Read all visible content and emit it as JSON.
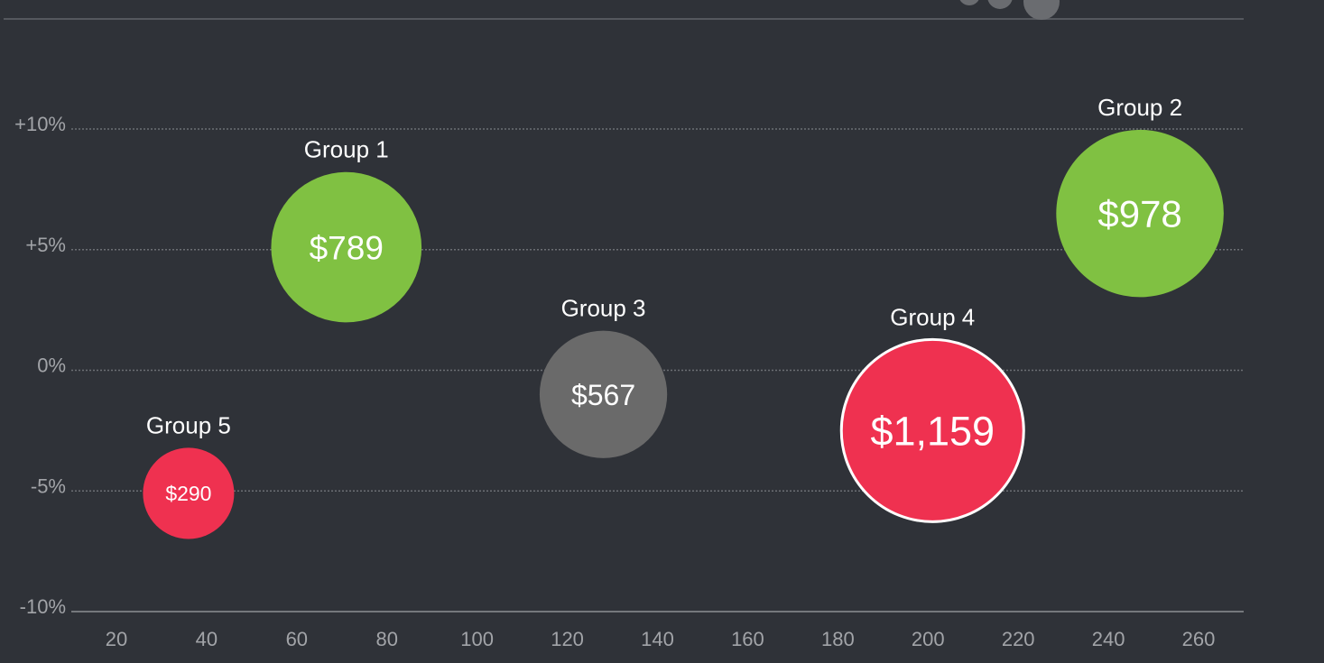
{
  "chart_data": {
    "type": "scatter",
    "title": "",
    "xlabel": "",
    "ylabel": "",
    "xlim": [
      10,
      270
    ],
    "ylim": [
      -10,
      10
    ],
    "x_ticks": [
      20,
      40,
      60,
      80,
      100,
      120,
      140,
      160,
      180,
      200,
      220,
      240,
      260
    ],
    "x_tick_labels": [
      "20",
      "40",
      "60",
      "80",
      "100",
      "120",
      "140",
      "160",
      "180",
      "200",
      "220",
      "240",
      "260"
    ],
    "y_ticks": [
      10,
      5,
      0,
      -5,
      -10
    ],
    "y_tick_labels": [
      "+10%",
      "+5%",
      "0%",
      "-5%",
      "-10%"
    ],
    "grid": "horizontal dotted",
    "points": [
      {
        "name": "Group 1",
        "x": 71,
        "y": 5.1,
        "size": 789,
        "label": "$789",
        "color": "#80c142",
        "highlight": false
      },
      {
        "name": "Group 2",
        "x": 247,
        "y": 6.5,
        "size": 978,
        "label": "$978",
        "color": "#80c142",
        "highlight": false
      },
      {
        "name": "Group 3",
        "x": 128,
        "y": -1.0,
        "size": 567,
        "label": "$567",
        "color": "#6a6a6a",
        "highlight": false
      },
      {
        "name": "Group 4",
        "x": 201,
        "y": -2.5,
        "size": 1159,
        "label": "$1,159",
        "color": "#ef3150",
        "highlight": true
      },
      {
        "name": "Group 5",
        "x": 36,
        "y": -5.1,
        "size": 290,
        "label": "$290",
        "color": "#ef3150",
        "highlight": false
      }
    ]
  }
}
